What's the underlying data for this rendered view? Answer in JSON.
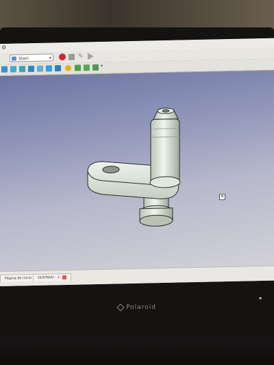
{
  "toolbar": {
    "workbench_label": "Start"
  },
  "taskbar": {
    "tabs": [
      "Página de inicio",
      "GUSTAVO : 1"
    ]
  },
  "monitor": {
    "brand": "Polaroid"
  },
  "colors": {
    "record_button": "#d8242b",
    "viewport_top": "#5d6796",
    "viewport_bottom": "#d6d5d9",
    "part_fill": "#dfe9dd"
  },
  "icons": [
    "workbench-icon",
    "record-macro-icon",
    "stop-macro-icon",
    "edit-macro-icon",
    "run-macro-icon",
    "view-cube-icon"
  ]
}
